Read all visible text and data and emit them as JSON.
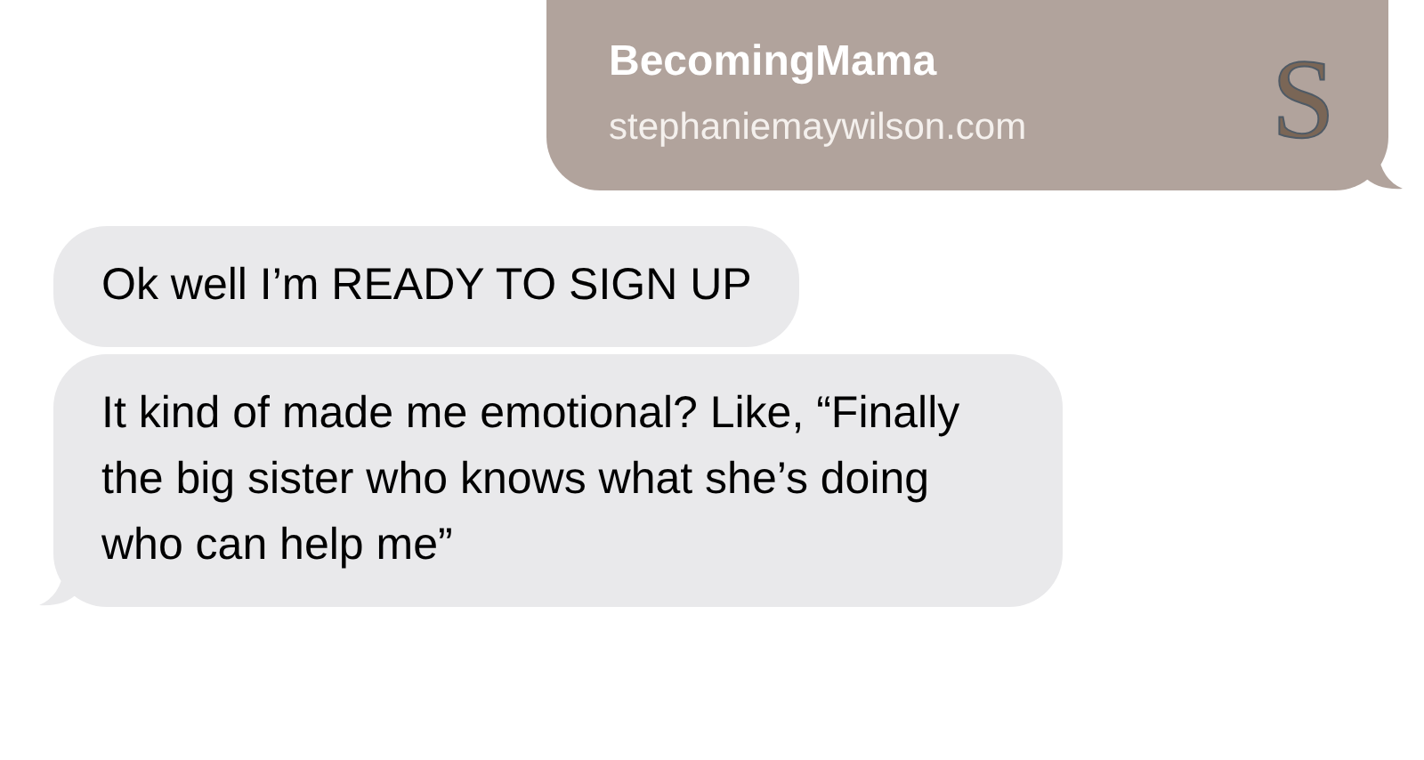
{
  "messages": [
    {
      "kind": "link",
      "from_me": true,
      "tail": true,
      "title": "BecomingMama",
      "url": "stephaniemaywilson.com",
      "logo_letter": "S"
    },
    {
      "kind": "text",
      "from_me": false,
      "tail": false,
      "text": "Ok well I’m READY TO SIGN UP"
    },
    {
      "kind": "text",
      "from_me": false,
      "tail": true,
      "text": "It kind of made me emotional? Like, “Finally the big sister who knows what she’s doing who can help me”"
    }
  ]
}
